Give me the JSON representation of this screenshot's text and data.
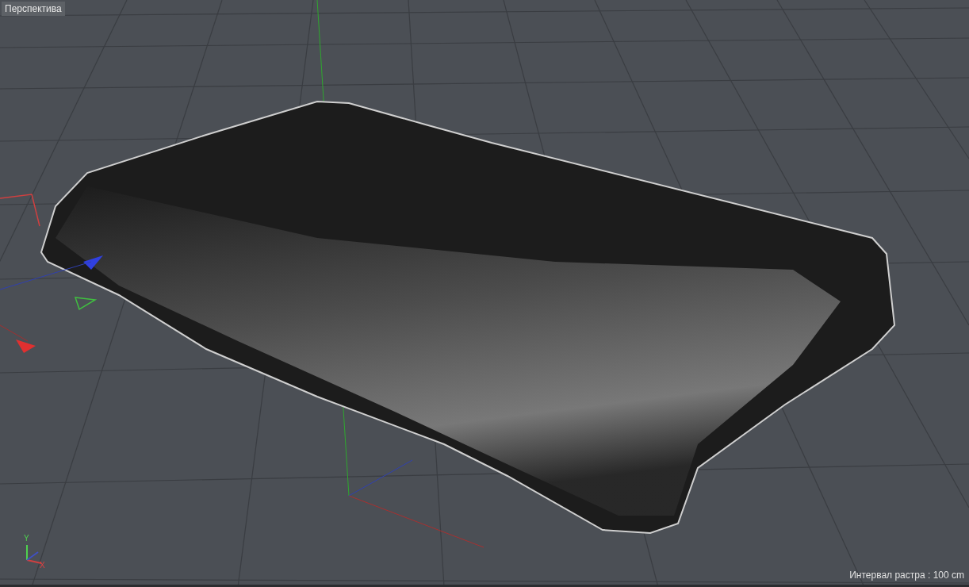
{
  "viewport": {
    "title": "Перспектива",
    "grid_info": "Интервал растра : 100 cm"
  },
  "axis_gizmo": {
    "y_label": "Y",
    "x_label": "X"
  }
}
